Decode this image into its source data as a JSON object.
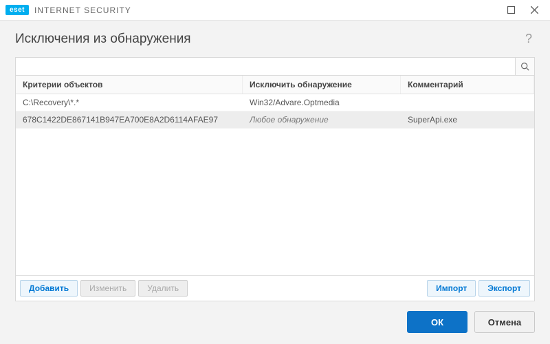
{
  "titlebar": {
    "brand_badge": "eset",
    "brand_text": "INTERNET SECURITY"
  },
  "header": {
    "title": "Исключения из обнаружения",
    "help_symbol": "?"
  },
  "search": {
    "placeholder": ""
  },
  "table": {
    "columns": {
      "criteria": "Критерии объектов",
      "exclude": "Исключить обнаружение",
      "comment": "Комментарий"
    },
    "rows": [
      {
        "criteria": "C:\\Recovery\\*.*",
        "exclude": "Win32/Advare.Optmedia",
        "comment": "",
        "italic_exclude": false,
        "selected": false
      },
      {
        "criteria": "678C1422DE867141B947EA700E8A2D6114AFAE97",
        "exclude": "Любое обнаружение",
        "comment": "SuperApi.exe",
        "italic_exclude": true,
        "selected": true
      }
    ]
  },
  "panel_buttons": {
    "add": "Добавить",
    "edit": "Изменить",
    "delete": "Удалить",
    "import": "Импорт",
    "export": "Экспорт"
  },
  "footer": {
    "ok": "ОК",
    "cancel": "Отмена"
  }
}
